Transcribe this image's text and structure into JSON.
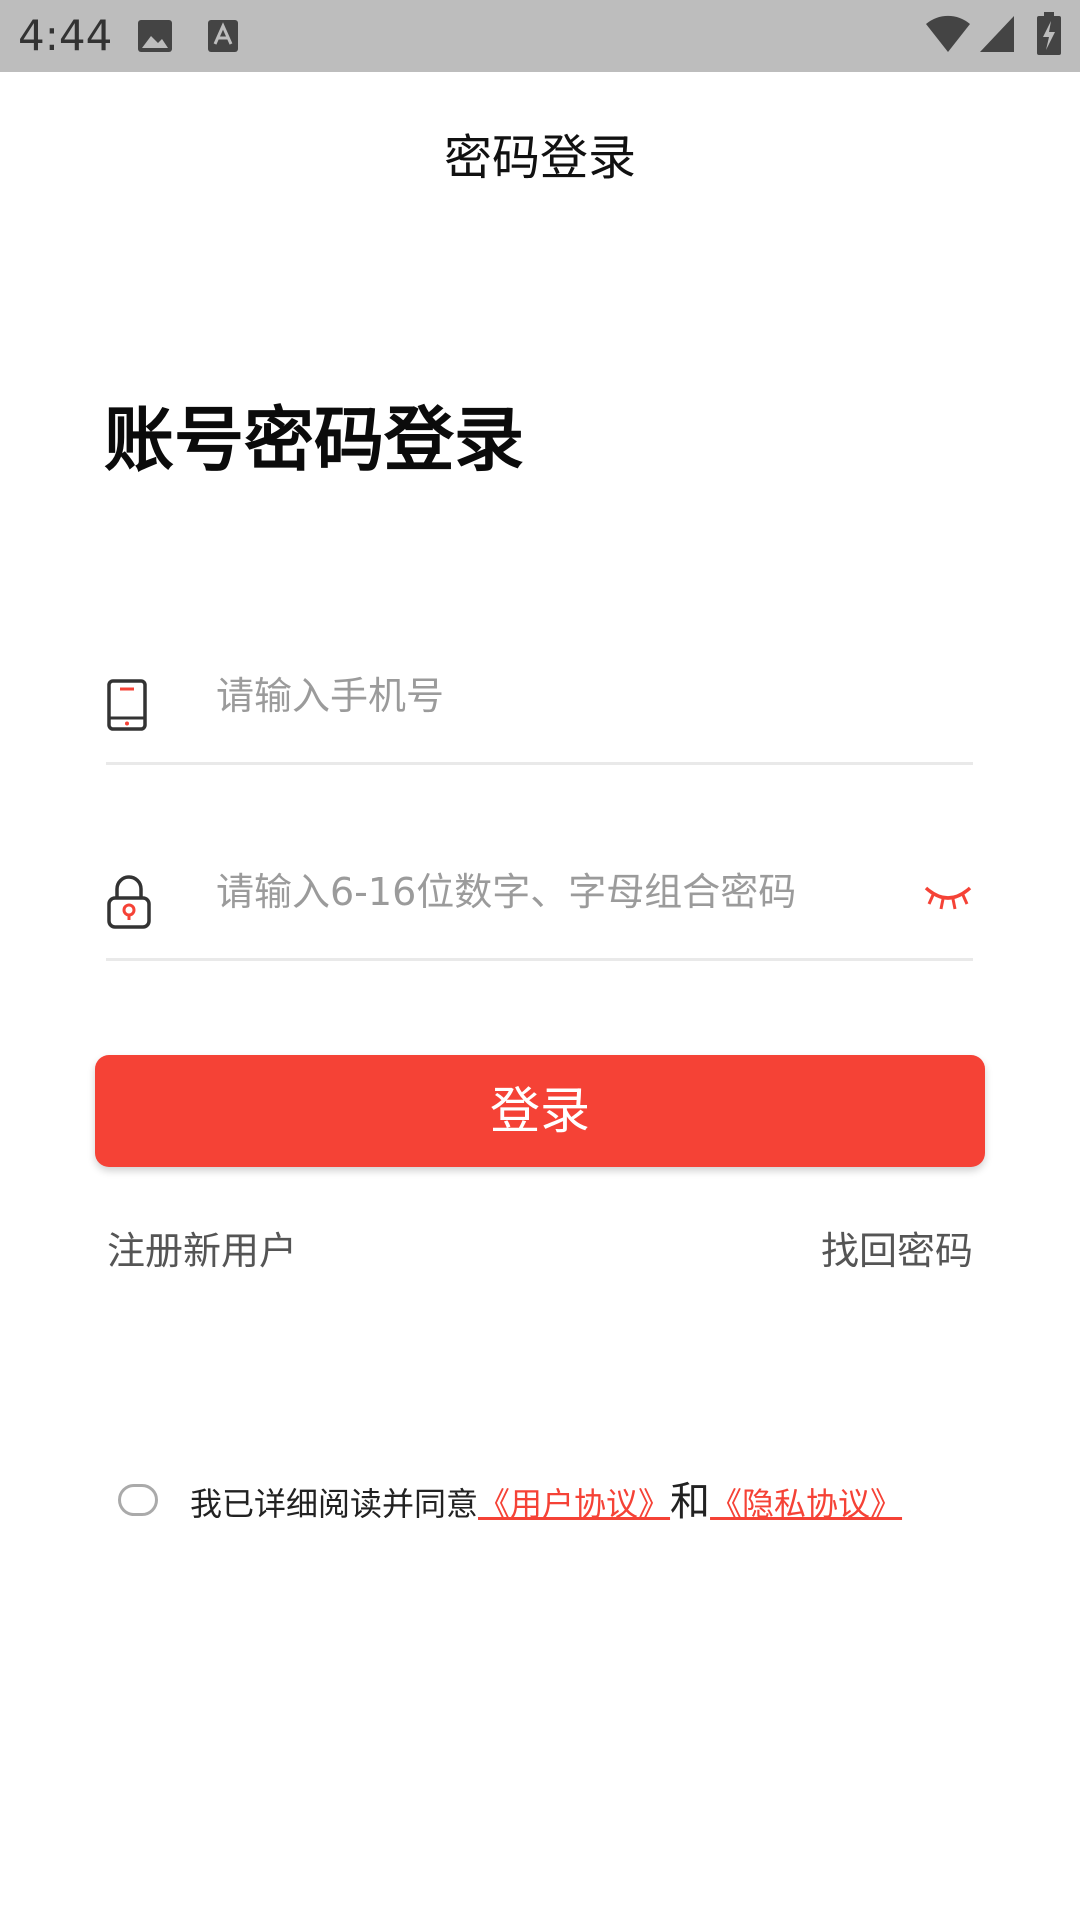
{
  "status_bar": {
    "time": "4:44"
  },
  "header": {
    "title": "密码登录"
  },
  "main": {
    "title": "账号密码登录",
    "phone_placeholder": "请输入手机号",
    "password_placeholder": "请输入6-16位数字、字母组合密码",
    "login_label": "登录",
    "register_label": "注册新用户",
    "forgot_label": "找回密码"
  },
  "agreement": {
    "prefix": "我已详细阅读并同意",
    "user_agreement": "《用户协议》",
    "and": "和",
    "privacy_agreement": "《隐私协议》"
  },
  "colors": {
    "accent": "#f54236",
    "status_bar_bg": "#bdbdbd"
  },
  "icons": {
    "phone": "phone-icon",
    "lock": "lock-icon",
    "eye": "eye-closed-icon",
    "wifi": "wifi-icon",
    "signal": "signal-icon",
    "battery": "battery-icon",
    "image": "image-icon",
    "keyboard": "keyboard-icon"
  }
}
